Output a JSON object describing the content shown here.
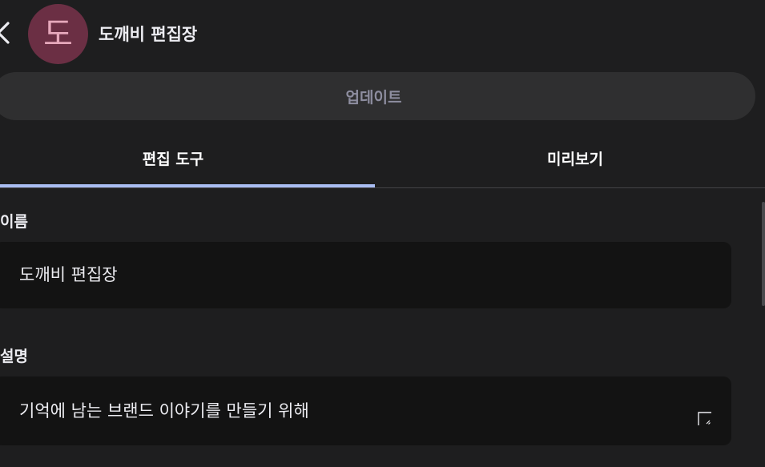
{
  "header": {
    "avatar_letter": "도",
    "gpt_name": "도깨비 편집장"
  },
  "actions": {
    "update_label": "업데이트"
  },
  "tabs": [
    {
      "label": "편집 도구",
      "active": true
    },
    {
      "label": "미리보기",
      "active": false
    }
  ],
  "form": {
    "name": {
      "label": "이름",
      "value": "도깨비 편집장"
    },
    "description": {
      "label": "설명",
      "value": "기억에 남는 브랜드 이야기를 만들기 위해"
    }
  },
  "colors": {
    "background": "#1e1e1f",
    "avatar_bg": "#6b2f44",
    "avatar_fg": "#e6a8bb",
    "tab_active_underline": "#a9bdf2",
    "input_bg": "#131313"
  }
}
